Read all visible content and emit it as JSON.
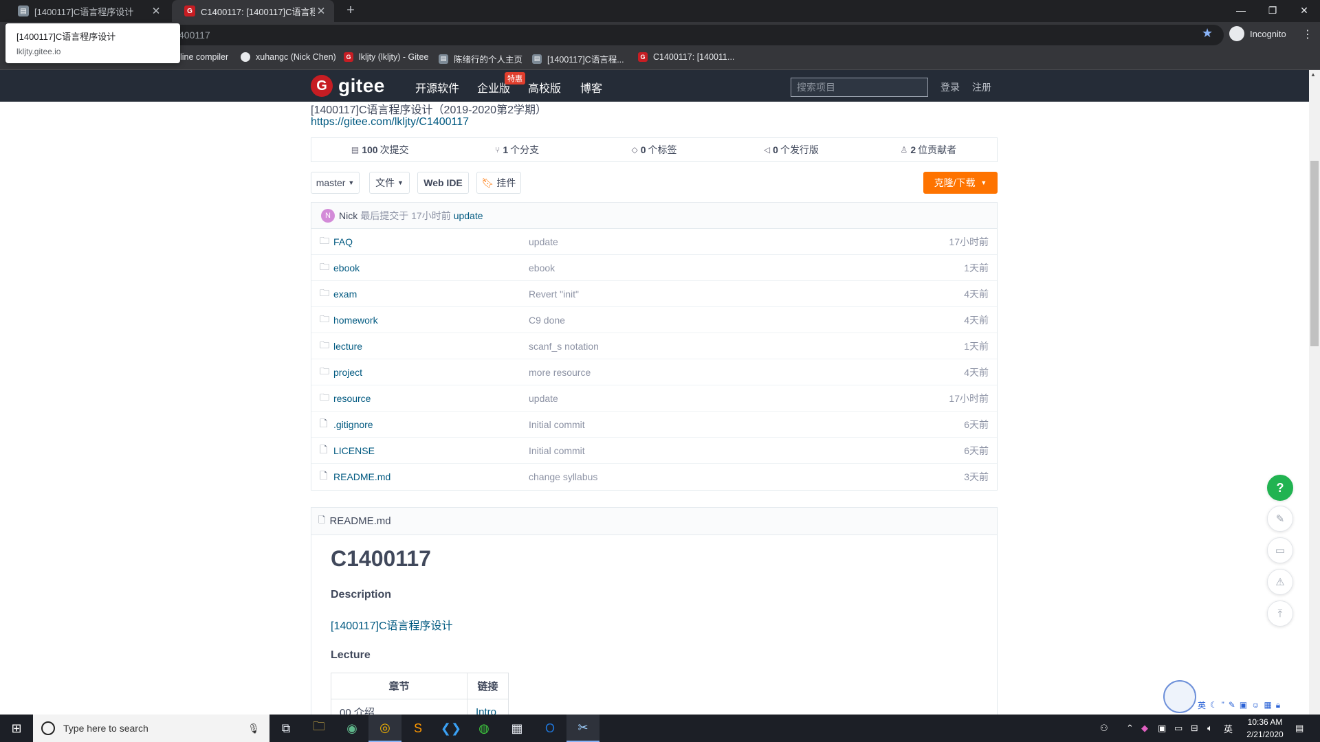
{
  "browser": {
    "tabs": [
      {
        "title": "[1400117]C语言程序设计",
        "favicon": "site-icon"
      },
      {
        "title": "C1400117: [1400117]C语言程序设...",
        "favicon": "gitee-icon"
      }
    ],
    "url_partial": "400117",
    "incognito_label": "Incognito",
    "tooltip": {
      "title": "[1400117]C语言程序设计",
      "domain": "lkljty.gitee.io"
    },
    "bookmarks": [
      {
        "label": "line compiler"
      },
      {
        "label": "xuhangc (Nick Chen)"
      },
      {
        "label": "lkljty (lkljty) - Gitee"
      },
      {
        "label": "陈绪行的个人主页"
      },
      {
        "label": "[1400117]C语言程..."
      },
      {
        "label": "C1400117: [140011..."
      }
    ]
  },
  "gitee": {
    "logo_text": "gitee",
    "nav": [
      "开源软件",
      "企业版",
      "高校版",
      "博客"
    ],
    "enterprise_badge": "特惠",
    "search_placeholder": "搜索项目",
    "login": "登录",
    "register": "注册"
  },
  "project": {
    "title": "[1400117]C语言程序设计（2019-2020第2学期）",
    "url": "https://gitee.com/lkljty/C1400117",
    "stats": [
      {
        "count": "100",
        "label": "次提交",
        "icon": "commit-icon"
      },
      {
        "count": "1",
        "label": "个分支",
        "icon": "branch-icon"
      },
      {
        "count": "0",
        "label": "个标签",
        "icon": "tag-icon"
      },
      {
        "count": "0",
        "label": "个发行版",
        "icon": "release-icon"
      },
      {
        "count": "2",
        "label": "位贡献者",
        "icon": "contributors-icon"
      }
    ],
    "toolbar": {
      "branch": "master",
      "file": "文件",
      "webide": "Web IDE",
      "plugin": "挂件",
      "clone": "克隆/下载"
    },
    "last_commit": {
      "avatar_letter": "N",
      "author": "Nick",
      "prefix": "最后提交于",
      "time": "17小时前",
      "message": "update"
    },
    "files": [
      {
        "name": "FAQ",
        "type": "folder",
        "message": "update",
        "time": "17小时前"
      },
      {
        "name": "ebook",
        "type": "folder",
        "message": "ebook",
        "time": "1天前"
      },
      {
        "name": "exam",
        "type": "folder",
        "message": "Revert \"init\"",
        "time": "4天前"
      },
      {
        "name": "homework",
        "type": "folder",
        "message": "C9 done",
        "time": "4天前"
      },
      {
        "name": "lecture",
        "type": "folder",
        "message": "scanf_s notation",
        "time": "1天前"
      },
      {
        "name": "project",
        "type": "folder",
        "message": "more resource",
        "time": "4天前"
      },
      {
        "name": "resource",
        "type": "folder",
        "message": "update",
        "time": "17小时前"
      },
      {
        "name": ".gitignore",
        "type": "file",
        "message": "Initial commit",
        "time": "6天前"
      },
      {
        "name": "LICENSE",
        "type": "file",
        "message": "Initial commit",
        "time": "6天前"
      },
      {
        "name": "README.md",
        "type": "file",
        "message": "change syllabus",
        "time": "3天前"
      }
    ]
  },
  "readme": {
    "filename": "README.md",
    "h1": "C1400117",
    "description_heading": "Description",
    "description_link": "[1400117]C语言程序设计",
    "lecture_heading": "Lecture",
    "table_headers": [
      "章节",
      "链接"
    ],
    "table_rows": [
      [
        "00 介绍",
        "Intro"
      ]
    ]
  },
  "taskbar": {
    "search_placeholder": "Type here to search",
    "time": "10:36 AM",
    "date": "2/21/2020",
    "ime": "英"
  },
  "colors": {
    "gitee_header": "#252c37",
    "clone_button": "#fe7300",
    "link": "#005980",
    "help_button": "#21b351"
  }
}
